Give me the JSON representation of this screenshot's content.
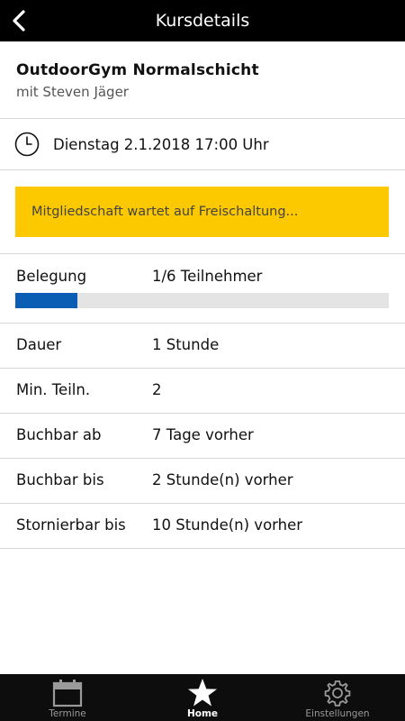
{
  "header": {
    "title": "Kursdetails"
  },
  "course": {
    "name": "OutdoorGym Normalschicht",
    "trainer": "mit Steven Jäger"
  },
  "schedule": {
    "datetime": "Dienstag 2.1.2018 17:00 Uhr"
  },
  "status": {
    "message": "Mitgliedschaft wartet auf Freischaltung...",
    "color": "#fcc800"
  },
  "occupancy": {
    "label": "Belegung",
    "value": "1/6 Teilnehmer",
    "booked": 1,
    "capacity": 6,
    "bar_color": "#0a5fb4"
  },
  "details": [
    {
      "label": "Dauer",
      "value": "1 Stunde"
    },
    {
      "label": "Min. Teiln.",
      "value": "2"
    },
    {
      "label": "Buchbar ab",
      "value": "7 Tage vorher"
    },
    {
      "label": "Buchbar bis",
      "value": "2 Stunde(n) vorher"
    },
    {
      "label": "Stornierbar bis",
      "value": "10 Stunde(n) vorher"
    }
  ],
  "tabs": [
    {
      "label": "Termine",
      "icon": "calendar-icon",
      "active": false
    },
    {
      "label": "Home",
      "icon": "star-icon",
      "active": true
    },
    {
      "label": "Einstellungen",
      "icon": "gear-icon",
      "active": false
    }
  ]
}
